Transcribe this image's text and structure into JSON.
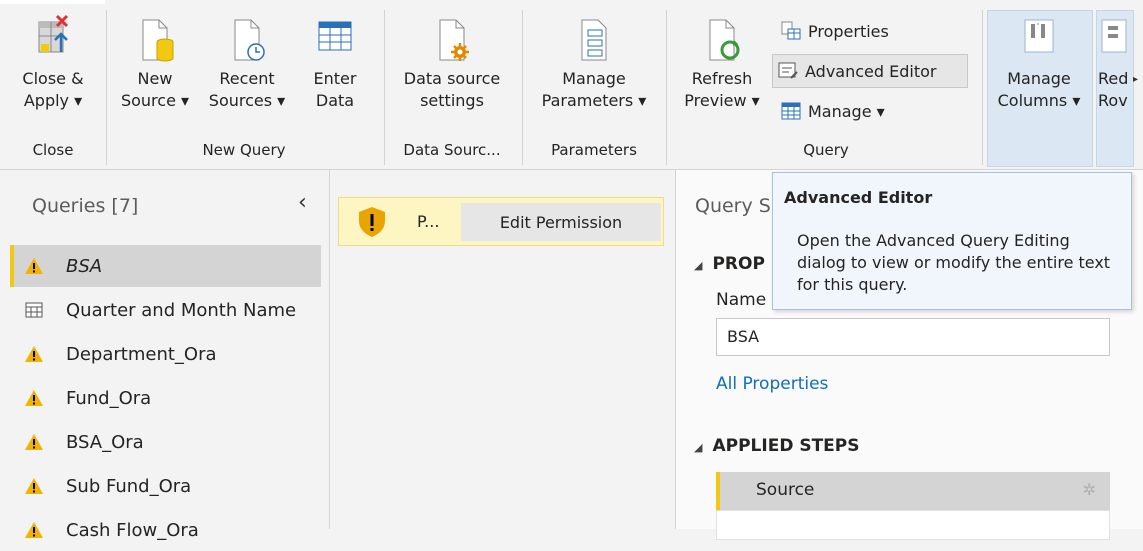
{
  "ribbon": {
    "close_apply": {
      "line1": "Close &",
      "line2": "Apply ▾"
    },
    "new_source": {
      "line1": "New",
      "line2": "Source ▾"
    },
    "recent_sources": {
      "line1": "Recent",
      "line2": "Sources ▾"
    },
    "enter_data": {
      "line1": "Enter",
      "line2": "Data"
    },
    "data_source_settings": {
      "line1": "Data source",
      "line2": "settings"
    },
    "manage_parameters": {
      "line1": "Manage",
      "line2": "Parameters ▾"
    },
    "refresh_preview": {
      "line1": "Refresh",
      "line2": "Preview ▾"
    },
    "properties": "Properties",
    "advanced_editor": "Advanced Editor",
    "manage": "Manage ▾",
    "manage_columns": {
      "line1": "Manage",
      "line2": "Columns ▾"
    },
    "reduce_rows": {
      "line1": "Red",
      "line2": "Rov"
    },
    "groups": {
      "close": "Close",
      "new_query": "New Query",
      "data_sources": "Data Sourc...",
      "parameters": "Parameters",
      "query": "Query"
    }
  },
  "queries": {
    "title": "Queries [7]",
    "collapse_glyph": "‹",
    "items": [
      {
        "label": "BSA",
        "icon": "warning-icon"
      },
      {
        "label": "Quarter and Month Name",
        "icon": "table-icon"
      },
      {
        "label": "Department_Ora",
        "icon": "warning-icon"
      },
      {
        "label": "Fund_Ora",
        "icon": "warning-icon"
      },
      {
        "label": "BSA_Ora",
        "icon": "warning-icon"
      },
      {
        "label": "Sub Fund_Ora",
        "icon": "warning-icon"
      },
      {
        "label": "Cash Flow_Ora",
        "icon": "warning-icon"
      }
    ]
  },
  "warning": {
    "text": "P...",
    "button": "Edit Permission"
  },
  "query_settings": {
    "title": "Query S",
    "properties_header": "PROP",
    "name_label": "Name",
    "name_value": "BSA",
    "all_properties": "All Properties",
    "applied_steps_header": "APPLIED STEPS",
    "steps": [
      "Source"
    ]
  },
  "tooltip": {
    "title": "Advanced Editor",
    "body": "Open the Advanced Query Editing dialog to view or modify the entire text for this query."
  },
  "colors": {
    "accent": "#f2c811",
    "link": "#106ebe",
    "warn_bg": "#fdf6c3",
    "tooltip_bg": "#f0f6fb"
  }
}
